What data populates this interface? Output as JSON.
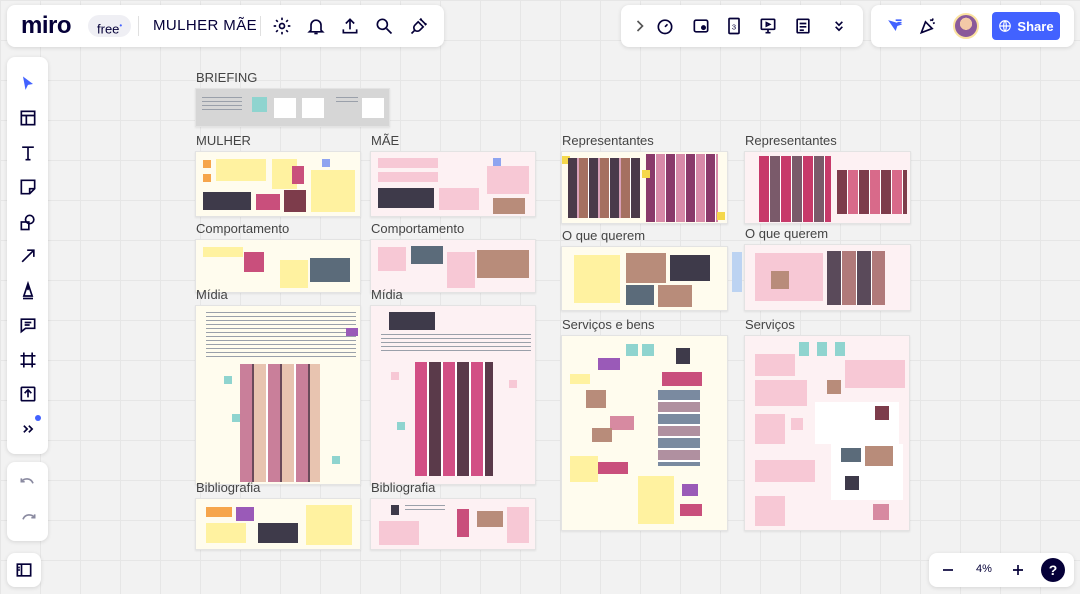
{
  "app": {
    "logo": "miro",
    "plan_badge": "free",
    "board_title": "MULHER MÃE",
    "share_label": "Share",
    "zoom_level": "4%",
    "help_label": "?"
  },
  "colors": {
    "accent": "#4262ff",
    "share_bg": "#4262ff",
    "sticky_yellow": "#fff2a0",
    "sticky_pink": "#f7c8d5",
    "sticky_orange": "#f6a54b",
    "sticky_blue": "#8fa4f0",
    "sticky_teal": "#8fd4cf"
  },
  "toolbar": {
    "top_left_icons": [
      "settings-icon",
      "bell-icon",
      "upload-icon",
      "search-icon",
      "plug-icon"
    ],
    "top_center_icons": [
      "chevron-right-icon",
      "timer-icon",
      "voting-icon",
      "card-icon",
      "present-icon",
      "notes-icon",
      "chevron-down-icon"
    ],
    "top_right_icons": [
      "cursor-flag-icon",
      "celebrate-icon",
      "avatar"
    ],
    "left_tools": [
      "select-icon",
      "template-icon",
      "text-icon",
      "sticky-note-icon",
      "shapes-icon",
      "arrow-icon",
      "pen-icon",
      "comment-icon",
      "frame-icon",
      "upload-icon",
      "more-tools-icon"
    ],
    "undo_redo": [
      "undo-icon",
      "redo-icon"
    ]
  },
  "frames": {
    "briefing": "BRIEFING",
    "mulher": "MULHER",
    "mae": "MÃE",
    "comportamento_1": "Comportamento",
    "comportamento_2": "Comportamento",
    "midia_1": "Mídia",
    "midia_2": "Mídia",
    "bibliografia_1": "Bibliografia",
    "bibliografia_2": "Bibliografia",
    "representantes_1": "Representantes",
    "representantes_2": "Representantes",
    "o_que_querem_1": "O que querem",
    "o_que_querem_2": "O que querem",
    "servicos_e_bens": "Serviços e bens",
    "servicos": "Serviços"
  }
}
